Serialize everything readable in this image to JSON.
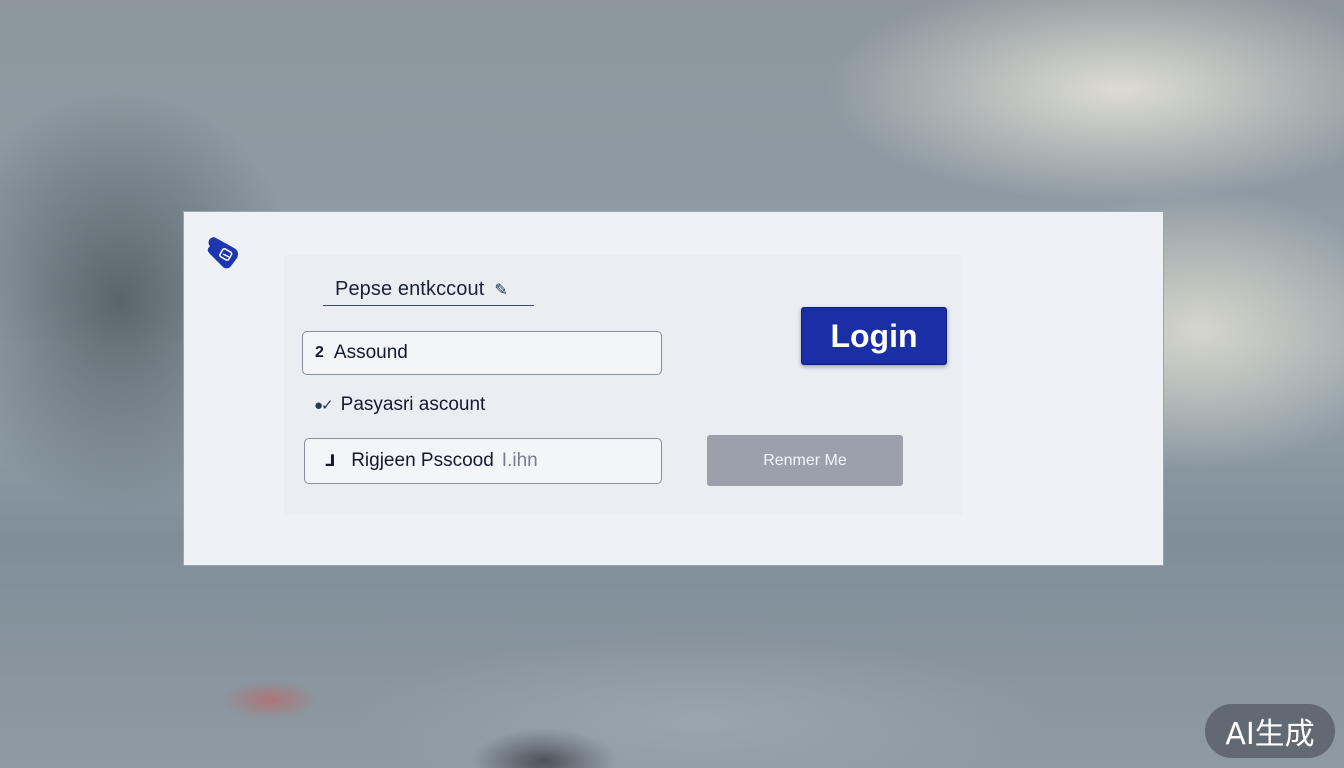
{
  "app": {
    "logo_icon": "shield-tag-icon",
    "accent_color": "#1a2fa6"
  },
  "form": {
    "heading": "Pepse entkccout",
    "heading_icon": "pencil-icon",
    "account_field": {
      "prefix": "2",
      "value": "Assound"
    },
    "password_label": {
      "icon": "toggle-check-icon",
      "text": "Pasyasri ascount"
    },
    "password_field": {
      "prefix": "⅃",
      "value": "Rigjeen Psscood",
      "trailing": "I.ihn"
    },
    "login_button": "Login",
    "remember_button": "Renmer Me"
  },
  "watermark": "AI生成"
}
